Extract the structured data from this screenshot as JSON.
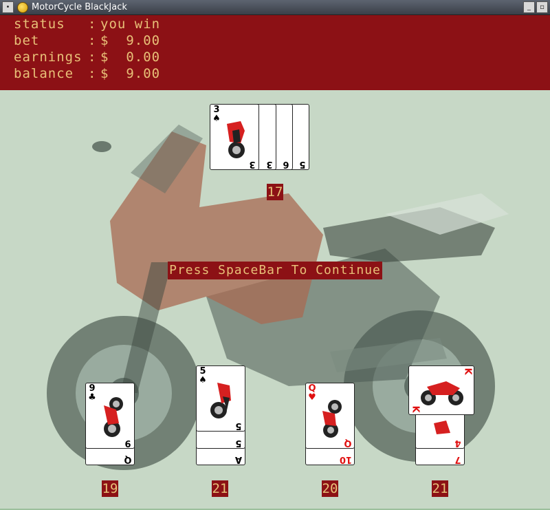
{
  "window": {
    "title": "MotorCycle BlackJack",
    "icon": "python-icon"
  },
  "hud": {
    "status_label": "status",
    "status_value": "you win",
    "bet_label": "bet",
    "bet_value": "$  9.00",
    "earnings_label": "earnings",
    "earnings_value": "$  0.00",
    "balance_label": "balance",
    "balance_value": "$  9.00",
    "separator": ":"
  },
  "dealer": {
    "total": "17",
    "cards": [
      {
        "rank": "3",
        "suit": "♠",
        "color": "black"
      },
      {
        "rank": "3",
        "suit": "♠",
        "color": "black"
      },
      {
        "rank": "3",
        "suit": "♣",
        "color": "black"
      },
      {
        "rank": "6",
        "suit": "♠",
        "color": "black"
      },
      {
        "rank": "5",
        "suit": "♠",
        "color": "black"
      }
    ]
  },
  "prompt": "Press SpaceBar To Continue",
  "hands": [
    {
      "total": "19",
      "cards": [
        {
          "rank": "Q",
          "suit": "♣",
          "color": "black"
        },
        {
          "rank": "9",
          "suit": "♣",
          "color": "black"
        }
      ]
    },
    {
      "total": "21",
      "cards": [
        {
          "rank": "A",
          "suit": "♠",
          "color": "black"
        },
        {
          "rank": "5",
          "suit": "♣",
          "color": "black"
        },
        {
          "rank": "5",
          "suit": "♠",
          "color": "black"
        }
      ]
    },
    {
      "total": "20",
      "cards": [
        {
          "rank": "10",
          "suit": "♥",
          "color": "red"
        },
        {
          "rank": "Q",
          "suit": "♥",
          "color": "red"
        }
      ]
    },
    {
      "total": "21",
      "cards": [
        {
          "rank": "7",
          "suit": "♦",
          "color": "red"
        },
        {
          "rank": "4",
          "suit": "♦",
          "color": "red"
        },
        {
          "rank": "K",
          "suit": "♦",
          "color": "red"
        }
      ]
    }
  ],
  "colors": {
    "panel": "#8c1115",
    "text": "#e8c078",
    "table": "#c7d8c6"
  }
}
